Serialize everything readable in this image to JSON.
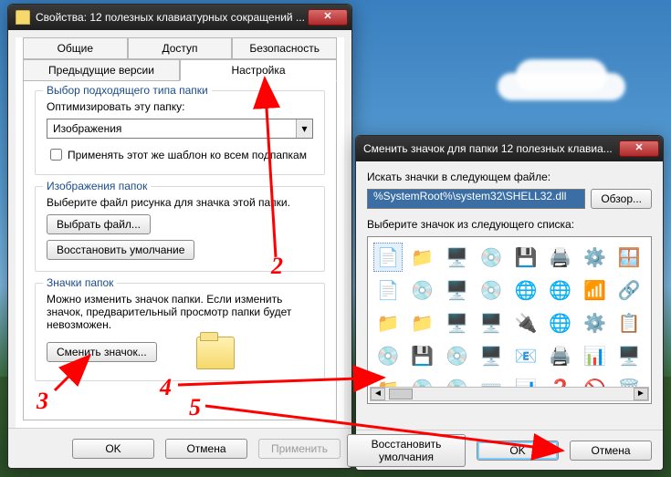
{
  "win1": {
    "title": "Свойства: 12 полезных клавиатурных сокращений ...",
    "tabs_row1": [
      "Общие",
      "Доступ",
      "Безопасность"
    ],
    "tabs_row2": [
      "Предыдущие версии",
      "Настройка"
    ],
    "active_tab": "Настройка",
    "group1": {
      "title": "Выбор подходящего типа папки",
      "label": "Оптимизировать эту папку:",
      "combo_value": "Изображения",
      "checkbox_label": "Применять этот же шаблон ко всем подпапкам",
      "checkbox_checked": false
    },
    "group2": {
      "title": "Изображения папок",
      "label": "Выберите файл рисунка для значка этой папки.",
      "btn_choose": "Выбрать файл...",
      "btn_restore": "Восстановить умолчание"
    },
    "group3": {
      "title": "Значки папок",
      "label": "Можно изменить значок папки. Если изменить значок, предварительный просмотр папки будет невозможен.",
      "btn_change": "Сменить значок..."
    },
    "buttons": {
      "ok": "OK",
      "cancel": "Отмена",
      "apply": "Применить"
    }
  },
  "win2": {
    "title": "Сменить значок для папки 12 полезных клавиа...",
    "label_path": "Искать значки в следующем файле:",
    "path_value": "%SystemRoot%\\system32\\SHELL32.dll",
    "btn_browse": "Обзор...",
    "label_list": "Выберите значок из следующего списка:",
    "btn_restore": "Восстановить умолчания",
    "buttons": {
      "ok": "OK",
      "cancel": "Отмена"
    },
    "icons": [
      "📄",
      "📁",
      "🖥️",
      "💿",
      "💾",
      "🖨️",
      "⚙️",
      "🪟",
      "📄",
      "💿",
      "🖥️",
      "💿",
      "🌐",
      "🌐",
      "📶",
      "🔗",
      "📁",
      "📁",
      "🖥️",
      "🖥️",
      "🔌",
      "🌐",
      "⚙️",
      "📋",
      "💿",
      "💾",
      "💿",
      "🖥️",
      "📧",
      "🖨️",
      "📊",
      "🖥️",
      "📁",
      "💿",
      "💿",
      "⌨️",
      "📊",
      "❓",
      "🚫",
      "🗑️"
    ]
  },
  "annotations": {
    "n2": "2",
    "n3": "3",
    "n4": "4",
    "n5": "5"
  }
}
